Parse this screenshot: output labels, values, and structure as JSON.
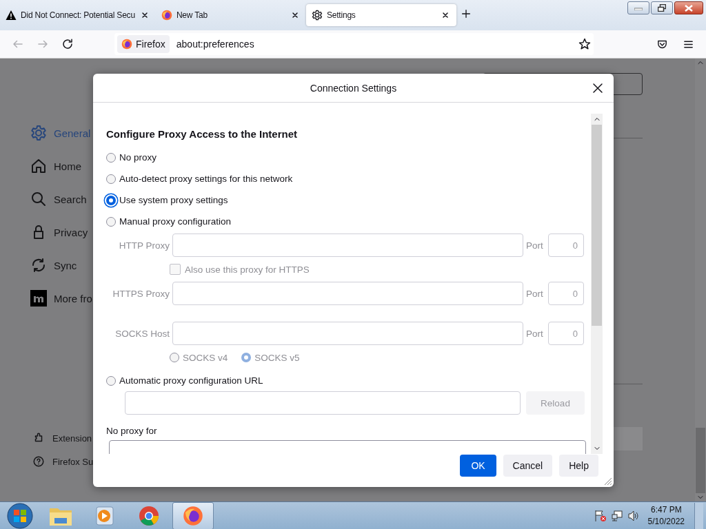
{
  "tabs": [
    {
      "title": "Did Not Connect: Potential Secu",
      "selected": false
    },
    {
      "title": "New Tab",
      "selected": false
    },
    {
      "title": "Settings",
      "selected": true
    }
  ],
  "toolbar": {
    "identity_label": "Firefox",
    "url": "about:preferences"
  },
  "sidebar": {
    "items": [
      {
        "label": "General",
        "selected": true
      },
      {
        "label": "Home",
        "selected": false
      },
      {
        "label": "Search",
        "selected": false
      },
      {
        "label": "Privacy",
        "selected": false
      },
      {
        "label": "Sync",
        "selected": false
      },
      {
        "label": "More fro",
        "selected": false
      }
    ],
    "footer_items": [
      {
        "label": "Extension"
      },
      {
        "label": "Firefox Su"
      }
    ]
  },
  "dialog": {
    "title": "Connection Settings",
    "heading": "Configure Proxy Access to the Internet",
    "proxy_options": [
      {
        "label": "No proxy",
        "selected": false
      },
      {
        "label": "Auto-detect proxy settings for this network",
        "selected": false
      },
      {
        "label": "Use system proxy settings",
        "selected": true
      },
      {
        "label": "Manual proxy configuration",
        "selected": false
      }
    ],
    "manual": {
      "disabled": true,
      "http": {
        "label": "HTTP Proxy",
        "port_label": "Port",
        "port": "0"
      },
      "also_https": {
        "label": "Also use this proxy for HTTPS",
        "checked": false
      },
      "https": {
        "label": "HTTPS Proxy",
        "port_label": "Port",
        "port": "0"
      },
      "socks": {
        "label": "SOCKS Host",
        "port_label": "Port",
        "port": "0"
      },
      "socks_versions": [
        {
          "label": "SOCKS v4",
          "selected": false
        },
        {
          "label": "SOCKS v5",
          "selected": true
        }
      ]
    },
    "auto_config": {
      "label": "Automatic proxy configuration URL",
      "selected": false,
      "disabled": true,
      "reload_button": "Reload"
    },
    "no_proxy_for": {
      "label": "No proxy for"
    },
    "buttons": [
      {
        "label": "OK",
        "kind": "primary"
      },
      {
        "label": "Cancel",
        "kind": "normal"
      },
      {
        "label": "Help",
        "kind": "normal"
      }
    ]
  },
  "taskbar": {
    "apps": [
      {
        "selected": false
      },
      {
        "selected": false
      },
      {
        "selected": false
      },
      {
        "selected": true
      }
    ],
    "clock": {
      "time": "6:47 PM",
      "date": "5/10/2022"
    }
  }
}
